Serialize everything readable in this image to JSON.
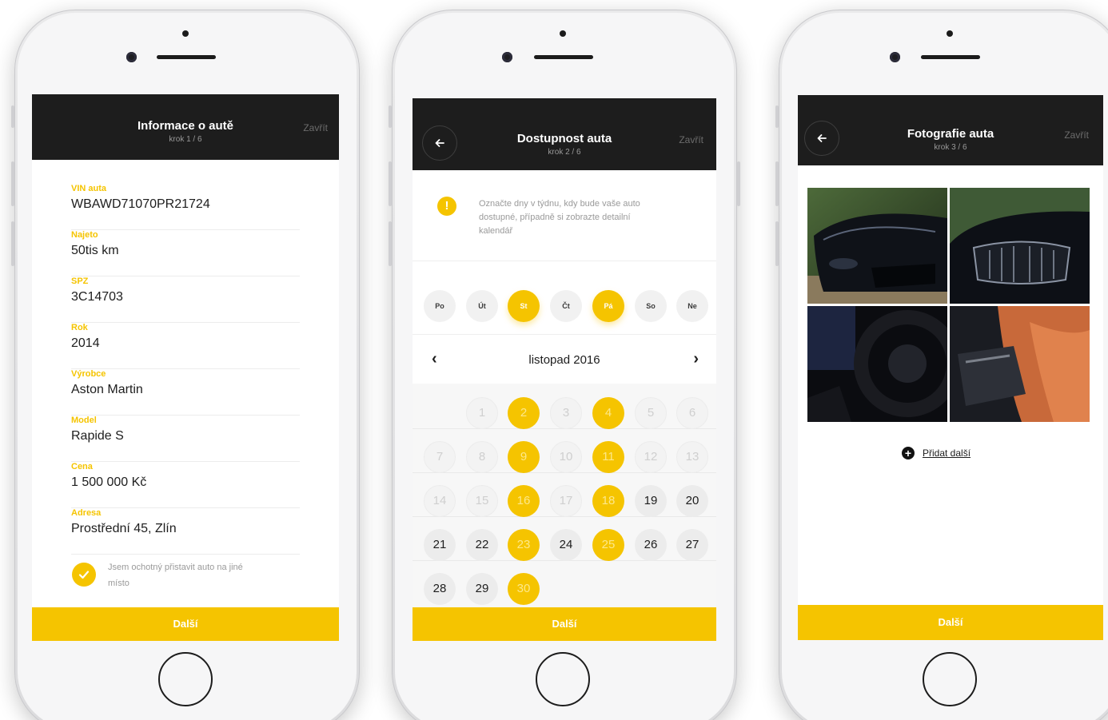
{
  "colors": {
    "accent": "#f5c400",
    "header_bg": "#1d1d1d",
    "text": "#1d1d1d",
    "muted": "#9a9a9a"
  },
  "screen1": {
    "title": "Informace o autě",
    "step": "krok 1 / 6",
    "close_label": "Zavřít",
    "fields": [
      {
        "label": "VIN auta",
        "value": "WBAWD71070PR21724"
      },
      {
        "label": "Najeto",
        "value": "50tis km"
      },
      {
        "label": "SPZ",
        "value": "3C14703"
      },
      {
        "label": "Rok",
        "value": "2014"
      },
      {
        "label": "Výrobce",
        "value": "Aston Martin"
      },
      {
        "label": "Model",
        "value": "Rapide S"
      },
      {
        "label": "Cena",
        "value": "1 500 000 Kč"
      },
      {
        "label": "Adresa",
        "value": "Prostřední 45, Zlín"
      }
    ],
    "checkbox_label_line1": "Jsem ochotný přistavit auto na jiné",
    "checkbox_label_line2": "místo",
    "checkbox_checked": true,
    "next_label": "Další"
  },
  "screen2": {
    "title": "Dostupnost auta",
    "step": "krok 2 / 6",
    "close_label": "Zavřít",
    "back_icon": "arrow-left-icon",
    "notice_icon_glyph": "!",
    "notice_line1": "Označte dny v týdnu, kdy bude vaše auto",
    "notice_line2": "dostupné, případně si zobrazte detailní",
    "notice_line3": "kalendář",
    "weekdays": [
      {
        "label": "Po",
        "on": false
      },
      {
        "label": "Út",
        "on": false
      },
      {
        "label": "St",
        "on": true
      },
      {
        "label": "Čt",
        "on": false
      },
      {
        "label": "Pá",
        "on": true
      },
      {
        "label": "So",
        "on": false
      },
      {
        "label": "Ne",
        "on": false
      }
    ],
    "month_label": "listopad 2016",
    "prev_glyph": "‹",
    "next_glyph": "›",
    "calendar_weeks": [
      [
        null,
        "1",
        "2",
        "3",
        "4",
        "5",
        "6"
      ],
      [
        "7",
        "8",
        "9",
        "10",
        "11",
        "12",
        "13"
      ],
      [
        "14",
        "15",
        "16",
        "17",
        "18",
        "19",
        "20"
      ],
      [
        "21",
        "22",
        "23",
        "24",
        "25",
        "26",
        "27"
      ],
      [
        "28",
        "29",
        "30",
        null,
        null,
        null,
        null
      ]
    ],
    "available_days": [
      "2",
      "4",
      "9",
      "11",
      "16",
      "18",
      "23",
      "25",
      "30"
    ],
    "first_selectable_day": 19,
    "next_label": "Další"
  },
  "screen3": {
    "title": "Fotografie auta",
    "step": "krok 3 / 6",
    "close_label": "Zavřít",
    "back_icon": "arrow-left-icon",
    "add_more_glyph": "+",
    "add_more_label": "Přidat další",
    "next_label": "Další"
  }
}
